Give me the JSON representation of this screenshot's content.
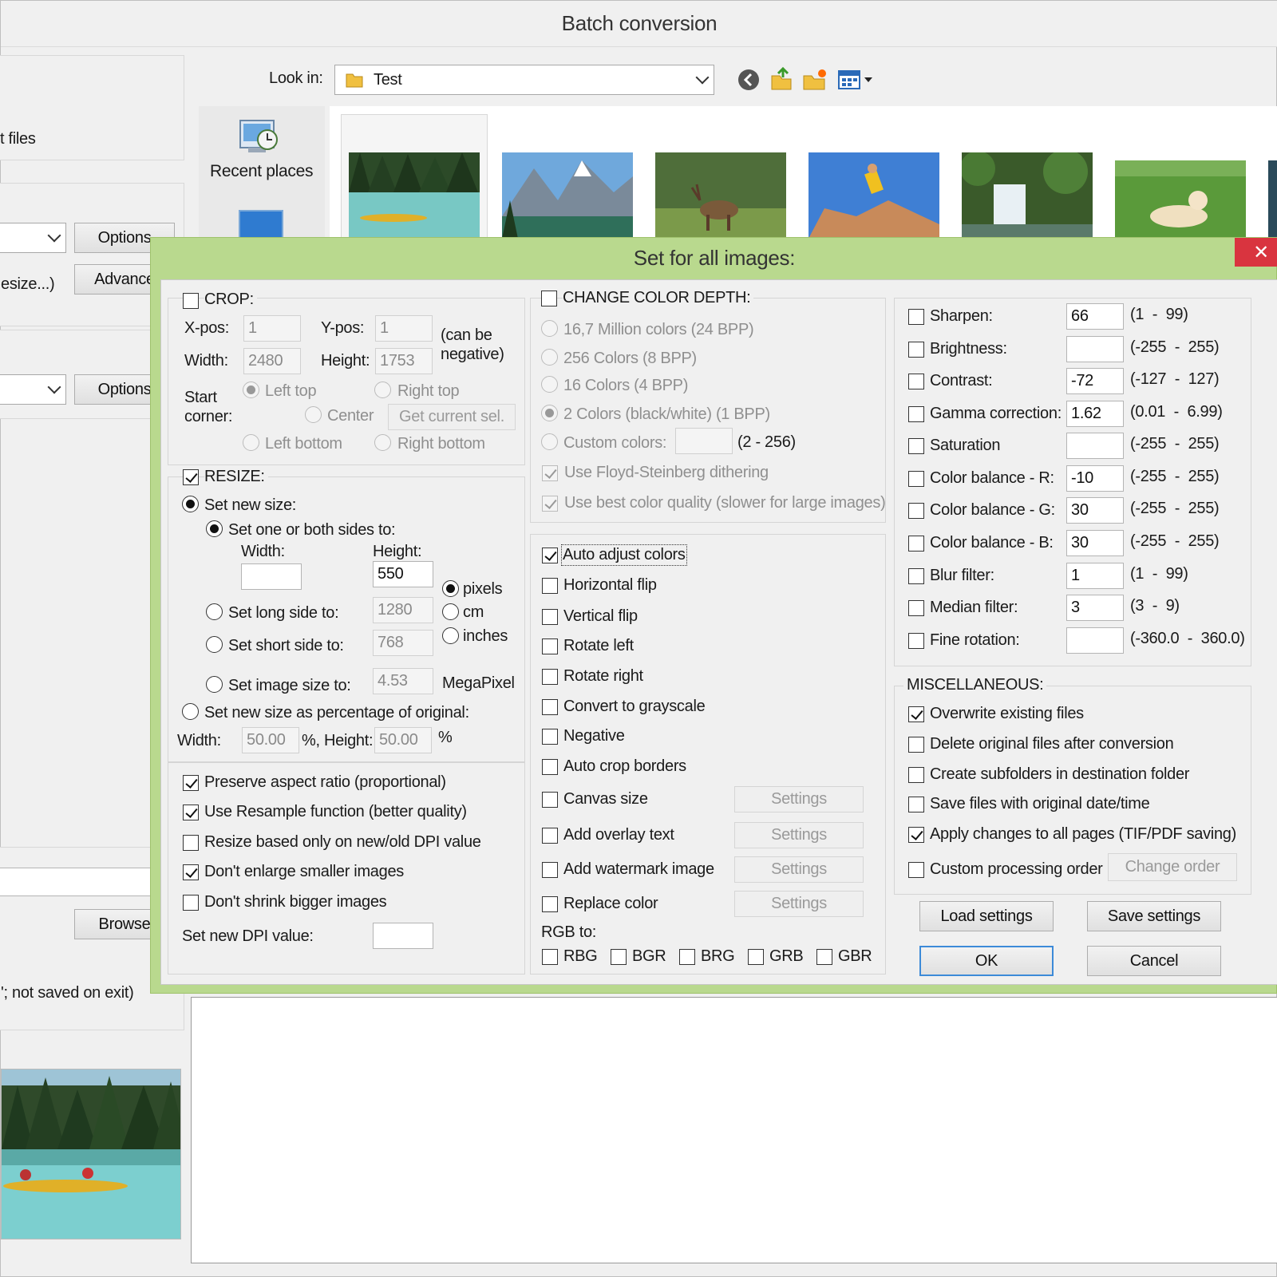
{
  "window": {
    "title": "Batch conversion"
  },
  "left_panel": {
    "files_label": "t files",
    "options1": "Options",
    "advanced": "Advance",
    "resize_partial": "esize...)",
    "options2": "Options",
    "browse": "Browse",
    "note": "'; not saved on exit)"
  },
  "browser": {
    "look_in_label": "Look in:",
    "folder": "Test",
    "recent_places": "Recent places"
  },
  "dialog": {
    "title": "Set for all images:",
    "close": "✕",
    "crop": {
      "label": "CROP:",
      "xpos_label": "X-pos:",
      "xpos": "1",
      "ypos_label": "Y-pos:",
      "ypos": "1",
      "can_be": "(can be",
      "negative": "negative)",
      "width_label": "Width:",
      "width": "2480",
      "height_label": "Height:",
      "height": "1753",
      "start": "Start",
      "corner": "corner:",
      "left_top": "Left top",
      "right_top": "Right top",
      "center": "Center",
      "get_current_sel": "Get current sel.",
      "left_bottom": "Left bottom",
      "right_bottom": "Right bottom"
    },
    "resize": {
      "label": "RESIZE:",
      "set_new_size": "Set new size:",
      "set_one_or_both": "Set one or both sides to:",
      "width_label": "Width:",
      "height_label": "Height:",
      "width": "",
      "height": "550",
      "pixels": "pixels",
      "cm": "cm",
      "inches": "inches",
      "set_long_side": "Set long side to:",
      "long_side": "1280",
      "set_short_side": "Set short side to:",
      "short_side": "768",
      "set_image_size": "Set image size to:",
      "image_size": "4.53",
      "megapixel": "MegaPixel",
      "set_percentage": "Set new size as percentage of original:",
      "pct_width_label": "Width:",
      "pct_width": "50.00",
      "pct_mid": "%, Height:",
      "pct_height": "50.00",
      "pct_end": "%",
      "preserve_aspect": "Preserve aspect ratio (proportional)",
      "use_resample": "Use Resample function (better quality)",
      "resize_dpi": "Resize based only on new/old DPI value",
      "dont_enlarge": "Don't enlarge smaller images",
      "dont_shrink": "Don't shrink bigger images",
      "set_dpi": "Set new DPI value:",
      "dpi": ""
    },
    "color_depth": {
      "label": "CHANGE COLOR DEPTH:",
      "c24": "16,7 Million colors (24 BPP)",
      "c8": "256 Colors (8 BPP)",
      "c4": "16 Colors (4 BPP)",
      "c1": "2 Colors (black/white) (1 BPP)",
      "custom": "Custom colors:",
      "custom_value": "",
      "custom_range": "(2 - 256)",
      "floyd": "Use Floyd-Steinberg dithering",
      "best_quality": "Use best color quality (slower for large images)"
    },
    "options": {
      "auto_adjust": "Auto adjust colors",
      "hflip": "Horizontal flip",
      "vflip": "Vertical flip",
      "rotate_left": "Rotate left",
      "rotate_right": "Rotate right",
      "grayscale": "Convert to grayscale",
      "negative": "Negative",
      "auto_crop": "Auto crop borders",
      "canvas_size": "Canvas size",
      "overlay_text": "Add overlay text",
      "watermark": "Add watermark image",
      "replace_color": "Replace color",
      "settings": "Settings",
      "rgb_to": "RGB to:",
      "rbg": "RBG",
      "bgr": "BGR",
      "brg": "BRG",
      "grb": "GRB",
      "gbr": "GBR"
    },
    "adjust": [
      {
        "label": "Sharpen:",
        "value": "66",
        "range": "(1  -  99)"
      },
      {
        "label": "Brightness:",
        "value": "",
        "range": "(-255  -  255)"
      },
      {
        "label": "Contrast:",
        "value": "-72",
        "range": "(-127  -  127)"
      },
      {
        "label": "Gamma correction:",
        "value": "1.62",
        "range": "(0.01  -  6.99)"
      },
      {
        "label": "Saturation",
        "value": "",
        "range": "(-255  -  255)"
      },
      {
        "label": "Color balance - R:",
        "value": "-10",
        "range": "(-255  -  255)"
      },
      {
        "label": "Color balance - G:",
        "value": "30",
        "range": "(-255  -  255)"
      },
      {
        "label": "Color balance - B:",
        "value": "30",
        "range": "(-255  -  255)"
      },
      {
        "label": "Blur filter:",
        "value": "1",
        "range": "(1  -  99)"
      },
      {
        "label": "Median filter:",
        "value": "3",
        "range": "(3  -  9)"
      },
      {
        "label": "Fine rotation:",
        "value": "",
        "range": "(-360.0  -  360.0)"
      }
    ],
    "misc": {
      "label": "MISCELLANEOUS:",
      "overwrite": "Overwrite existing files",
      "delete_original": "Delete original files after conversion",
      "create_subfolders": "Create subfolders in destination folder",
      "save_date": "Save files with original date/time",
      "apply_all_pages": "Apply changes to all pages (TIF/PDF saving)",
      "custom_order": "Custom processing order",
      "change_order": "Change order"
    },
    "buttons": {
      "load": "Load settings",
      "save": "Save settings",
      "ok": "OK",
      "cancel": "Cancel"
    }
  }
}
